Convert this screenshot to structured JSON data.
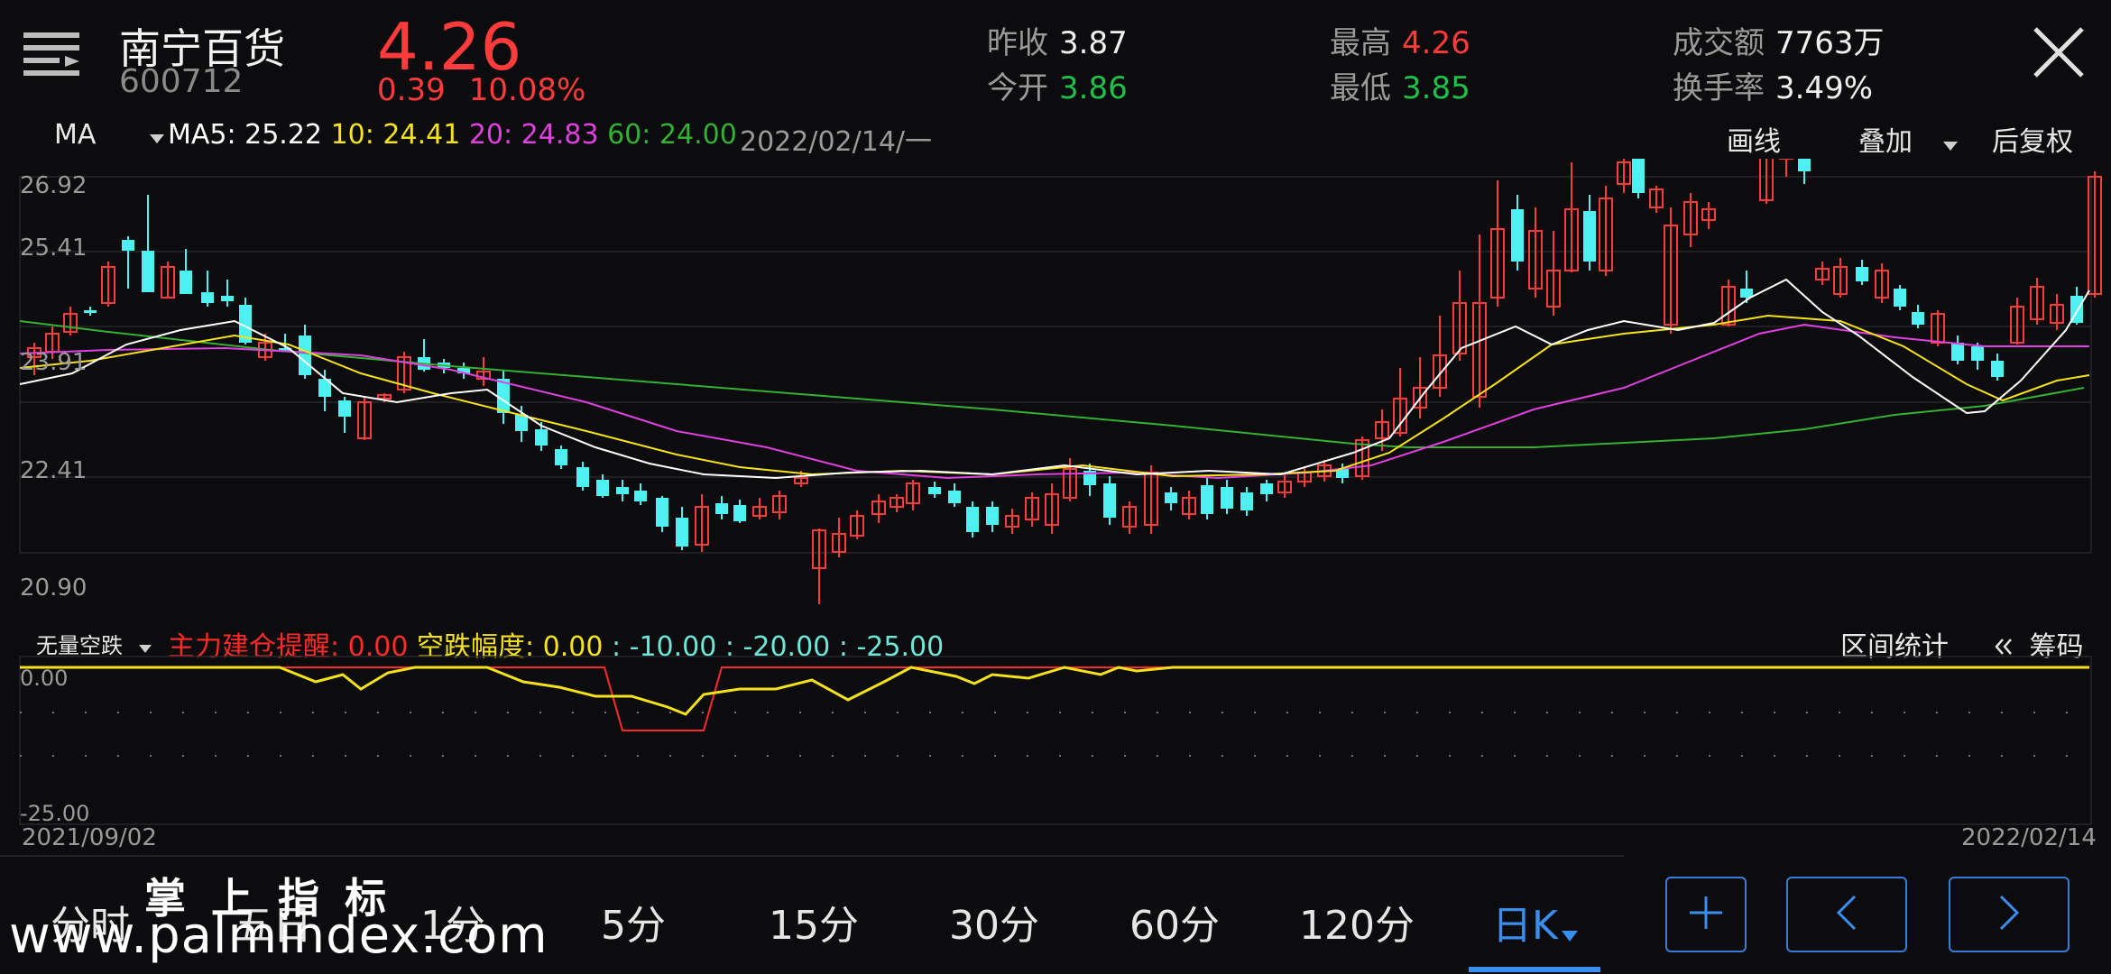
{
  "header": {
    "stock_name": "南宁百货",
    "stock_code": "600712",
    "price": "4.26",
    "change": "0.39",
    "change_pct": "10.08%",
    "stats": [
      {
        "label": "昨收",
        "value": "3.87",
        "color": "white"
      },
      {
        "label": "今开",
        "value": "3.86",
        "color": "green"
      },
      {
        "label": "最高",
        "value": "4.26",
        "color": "red"
      },
      {
        "label": "最低",
        "value": "3.85",
        "color": "green"
      },
      {
        "label": "成交额",
        "value": "7763万",
        "color": "white"
      },
      {
        "label": "换手率",
        "value": "3.49%",
        "color": "white"
      }
    ]
  },
  "ma_bar": {
    "indicator": "MA",
    "ma5": "MA5: 25.22",
    "ma10": "10: 24.41",
    "ma20": "20: 24.83",
    "ma60": "60: 24.00",
    "date": "2022/02/14/一",
    "draw_label": "画线",
    "overlay_label": "叠加",
    "adjust_label": "后复权"
  },
  "price_axis": [
    "26.92",
    "25.41",
    "23.91",
    "22.41",
    "20.90"
  ],
  "indicator_bar": {
    "name": "无量空跌",
    "line1": "主力建仓提醒: 0.00",
    "line2": "空跌幅度: 0.00",
    "line3": ": -10.00",
    "line4": ": -20.00",
    "line5": ": -25.00",
    "range_stats": "区间统计",
    "chips": "筹码"
  },
  "indicator_axis": [
    "0.00",
    "-25.00"
  ],
  "date_range": {
    "start": "2021/09/02",
    "end": "2022/02/14"
  },
  "period_tabs": [
    "分时",
    "五日",
    "1分",
    "5分",
    "15分",
    "30分",
    "60分",
    "120分",
    "日K"
  ],
  "active_tab": "日K",
  "watermark": {
    "url": "www.palmindex.com",
    "cn": "掌上指标"
  },
  "colors": {
    "up": "#ff3b3b",
    "down": "#4ff0f0",
    "ma5": "#ffffff",
    "ma10": "#f5e21a",
    "ma20": "#e040e0",
    "ma60": "#34b034",
    "accent": "#3a7bd5"
  }
}
